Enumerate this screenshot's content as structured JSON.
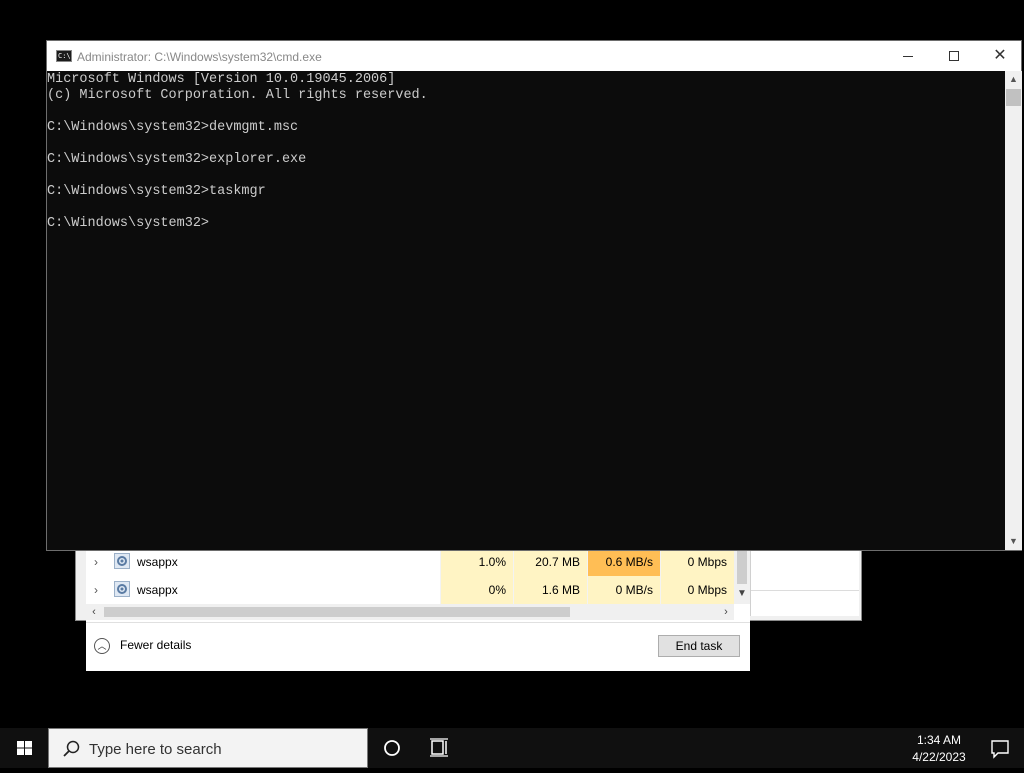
{
  "task_manager": {
    "rows": [
      {
        "name": "wsappx",
        "cpu": "1.0%",
        "memory": "20.7 MB",
        "disk": "0.6 MB/s",
        "network": "0 Mbps"
      },
      {
        "name": "wsappx",
        "cpu": "0%",
        "memory": "1.6 MB",
        "disk": "0 MB/s",
        "network": "0 Mbps"
      }
    ],
    "fewer_details_label": "Fewer details",
    "end_task_label": "End task",
    "colors": {
      "heat_light": "#fff4c4",
      "heat_hot": "#ffbe55"
    }
  },
  "cmd": {
    "title": "Administrator: C:\\Windows\\system32\\cmd.exe",
    "lines": [
      "Microsoft Windows [Version 10.0.19045.2006]",
      "(c) Microsoft Corporation. All rights reserved.",
      "",
      "C:\\Windows\\system32>devmgmt.msc",
      "",
      "C:\\Windows\\system32>explorer.exe",
      "",
      "C:\\Windows\\system32>taskmgr",
      "",
      "C:\\Windows\\system32>"
    ],
    "colors": {
      "background": "#0c0c0c",
      "text": "#cccccc"
    }
  },
  "taskbar": {
    "search_placeholder": "Type here to search",
    "time": "1:34 AM",
    "date": "4/22/2023",
    "icons": [
      "windows-start-icon",
      "search-icon",
      "cortana-icon",
      "task-view-icon",
      "notification-icon"
    ]
  }
}
